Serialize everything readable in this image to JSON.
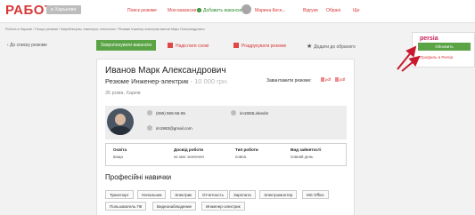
{
  "header": {
    "logo": "РАБОТА",
    "city": "в Харькове",
    "nav": [
      "Поиск резюме",
      "Мои вакансии",
      "Добавить вакансию"
    ],
    "user": "Марина Кисе...",
    "right": [
      "Відгуки",
      "Обрані",
      "Ще"
    ]
  },
  "breadcrumbs": "Робота в Харкові  /  Пошук резюме  /  Виробництво, інженери, технологи  /  Резюме Інженер-електрик Іванов Марк Олександрович",
  "toolbar": {
    "back": "До списку резюме",
    "invite": "Запропонувати вакансію",
    "similar": "Надіслати схожі",
    "print": "Роздрукувати резюме",
    "favorite": "Додати до обраного"
  },
  "resume": {
    "name": "Иванов Марк Александрович",
    "position": "Резюме Инженер-электрик",
    "salary": " - 10 000 грн.",
    "download_label": "Завантажити резюме:",
    "files": [
      "pdf",
      "pdf"
    ],
    "age_city": "35 років, Харків",
    "phone": "(066) 555-55-55",
    "linkedin": "im1983Linkedin",
    "email": "im1983@gmail.com",
    "stats": [
      {
        "title": "Освіта",
        "value": "вища"
      },
      {
        "title": "Досвід роботи",
        "value": "не має значення"
      },
      {
        "title": "Тип роботи",
        "value": "повна"
      },
      {
        "title": "Вид зайнятості",
        "value": "повний день"
      }
    ],
    "skills_title": "Професійні навички",
    "skills": [
      "Транспорт",
      "Начальник",
      "Электрик",
      "Отчетность",
      "Зарплата",
      "Электромонтер",
      "MS Office",
      "Пользователь ПК",
      "Видеонаблюдение",
      "Инженер-электрик"
    ]
  },
  "side": {
    "brand": "persia",
    "button": "Обновить",
    "link": "Профиль в Persia"
  }
}
